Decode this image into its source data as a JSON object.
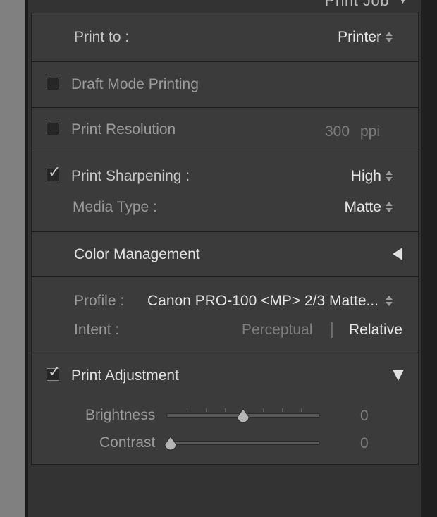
{
  "panel": {
    "title": "Print Job",
    "expanded": true
  },
  "print_to": {
    "label": "Print to :",
    "value": "Printer"
  },
  "draft_mode": {
    "label": "Draft Mode Printing",
    "checked": false
  },
  "print_resolution": {
    "label": "Print Resolution",
    "checked": false,
    "value": "300",
    "unit": "ppi"
  },
  "print_sharpening": {
    "label": "Print Sharpening :",
    "checked": true,
    "value": "High"
  },
  "media_type": {
    "label": "Media Type :",
    "value": "Matte"
  },
  "color_management": {
    "title": "Color Management",
    "expanded": true,
    "profile_label": "Profile :",
    "profile_value": "Canon PRO-100 <MP> 2/3 Matte...",
    "intent_label": "Intent :",
    "intent_options": [
      "Perceptual",
      "Relative"
    ],
    "intent_selected": "Relative"
  },
  "print_adjustment": {
    "label": "Print Adjustment",
    "checked": true,
    "expanded": true,
    "sliders": [
      {
        "label": "Brightness",
        "value": "0",
        "level": 0.5
      },
      {
        "label": "Contrast",
        "value": "0",
        "level": 0.0
      }
    ]
  },
  "colors": {
    "panel": "#3b3b3b",
    "text": "#c8c8c8",
    "selected": "#e6e6e6"
  }
}
